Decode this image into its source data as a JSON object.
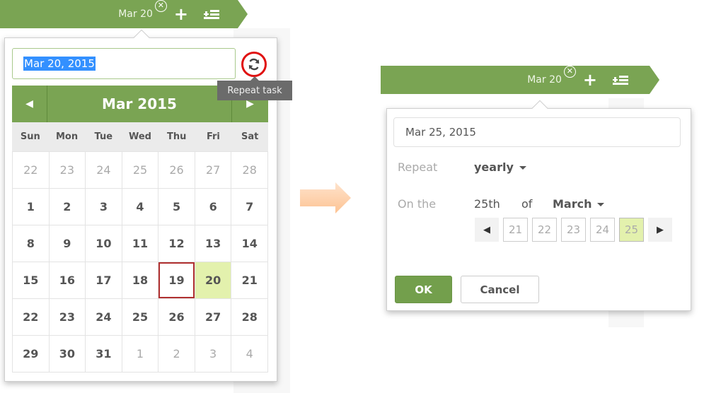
{
  "before": {
    "taskbar": {
      "due_date": "Mar 20",
      "clear_icon": "circle-x-icon",
      "add_icon": "plus-icon",
      "subtasks_icon": "add-list-icon"
    },
    "date_field": {
      "value": "Mar 20, 2015",
      "selected": true
    },
    "repeat_button": {
      "icon": "repeat-icon",
      "tooltip": "Repeat task",
      "highlight_color": "#e01010"
    },
    "calendar": {
      "prev_icon": "triangle-left-icon",
      "next_icon": "triangle-right-icon",
      "title": "Mar 2015",
      "weekdays": [
        "Sun",
        "Mon",
        "Tue",
        "Wed",
        "Thu",
        "Fri",
        "Sat"
      ],
      "weeks": [
        [
          {
            "d": "22",
            "other": true
          },
          {
            "d": "23",
            "other": true
          },
          {
            "d": "24",
            "other": true
          },
          {
            "d": "25",
            "other": true
          },
          {
            "d": "26",
            "other": true
          },
          {
            "d": "27",
            "other": true
          },
          {
            "d": "28",
            "other": true
          }
        ],
        [
          {
            "d": "1"
          },
          {
            "d": "2"
          },
          {
            "d": "3"
          },
          {
            "d": "4"
          },
          {
            "d": "5"
          },
          {
            "d": "6"
          },
          {
            "d": "7"
          }
        ],
        [
          {
            "d": "8"
          },
          {
            "d": "9"
          },
          {
            "d": "10"
          },
          {
            "d": "11"
          },
          {
            "d": "12"
          },
          {
            "d": "13"
          },
          {
            "d": "14"
          }
        ],
        [
          {
            "d": "15"
          },
          {
            "d": "16"
          },
          {
            "d": "17"
          },
          {
            "d": "18"
          },
          {
            "d": "19",
            "today": true
          },
          {
            "d": "20",
            "selected": true
          },
          {
            "d": "21"
          }
        ],
        [
          {
            "d": "22"
          },
          {
            "d": "23"
          },
          {
            "d": "24"
          },
          {
            "d": "25"
          },
          {
            "d": "26"
          },
          {
            "d": "27"
          },
          {
            "d": "28"
          }
        ],
        [
          {
            "d": "29"
          },
          {
            "d": "30"
          },
          {
            "d": "31"
          },
          {
            "d": "1",
            "other": true
          },
          {
            "d": "2",
            "other": true
          },
          {
            "d": "3",
            "other": true
          },
          {
            "d": "4",
            "other": true
          }
        ]
      ]
    }
  },
  "transition_icon": "arrow-right-icon",
  "after": {
    "taskbar": {
      "due_date": "Mar 20",
      "clear_icon": "circle-x-icon",
      "add_icon": "plus-icon",
      "subtasks_icon": "add-list-icon"
    },
    "date_field": {
      "value": "Mar 25, 2015"
    },
    "repeat": {
      "label": "Repeat",
      "value": "yearly"
    },
    "on_the": {
      "label": "On the",
      "day": "25th",
      "of_label": "of",
      "month": "March"
    },
    "day_picker": {
      "prev_icon": "triangle-left-icon",
      "next_icon": "triangle-right-icon",
      "days": [
        {
          "d": "21"
        },
        {
          "d": "22"
        },
        {
          "d": "23"
        },
        {
          "d": "24"
        },
        {
          "d": "25",
          "active": true
        }
      ]
    },
    "buttons": {
      "ok": "OK",
      "cancel": "Cancel"
    }
  },
  "colors": {
    "brand_green": "#7aa453",
    "selected_day": "#e3f1ad",
    "today_outline": "#b03030",
    "arrow": "#fdc79a"
  }
}
